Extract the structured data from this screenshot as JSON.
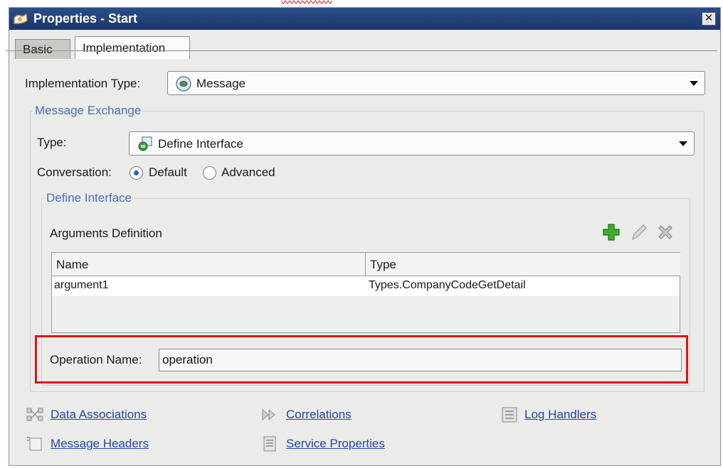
{
  "window": {
    "title": "Properties - Start",
    "close_glyph": "✕"
  },
  "tabs": [
    {
      "label": "Basic",
      "selected": false
    },
    {
      "label": "Implementation",
      "selected": true
    }
  ],
  "implementation_type": {
    "label": "Implementation Type:",
    "value": "Message",
    "icon": "message-icon"
  },
  "message_exchange": {
    "legend": "Message Exchange",
    "type_label": "Type:",
    "type_value": "Define Interface",
    "type_icon": "interface-icon",
    "conversation_label": "Conversation:",
    "conversation_options": [
      {
        "label": "Default",
        "selected": true
      },
      {
        "label": "Advanced",
        "selected": false
      }
    ]
  },
  "define_interface": {
    "legend": "Define Interface",
    "arguments_title": "Arguments Definition",
    "toolbar": {
      "add_icon": "add-icon",
      "edit_icon": "edit-icon",
      "delete_icon": "delete-icon"
    },
    "columns": [
      "Name",
      "Type"
    ],
    "rows": [
      {
        "name": "argument1",
        "type": "Types.CompanyCodeGetDetail"
      }
    ],
    "operation_label": "Operation Name:",
    "operation_value": "operation"
  },
  "links": {
    "data_associations": "Data Associations",
    "correlations": "Correlations",
    "log_handlers": "Log Handlers",
    "message_headers": "Message Headers",
    "service_properties": "Service Properties"
  },
  "colors": {
    "accent": "#4b6fb5",
    "highlight": "#e01414",
    "link": "#2346a8",
    "title_bar": "#1c366a"
  }
}
